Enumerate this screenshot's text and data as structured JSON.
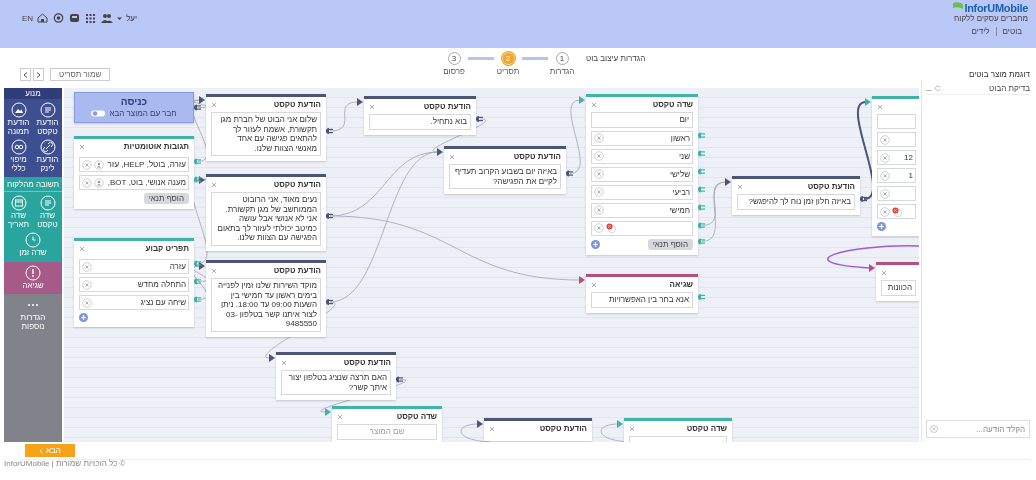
{
  "header": {
    "language": "EN",
    "user": "יעל",
    "logo": {
      "name": "InforUMobile",
      "tagline": "מחברים עסקים ללקוח"
    },
    "nav": [
      "בוטים",
      "לידים"
    ]
  },
  "toolbar": {
    "save_button": "שמור תסריט"
  },
  "stepper": {
    "title": "הגדרות עיצוב בוט",
    "steps": [
      {
        "number": "1",
        "label": "הגדרות",
        "selected": false
      },
      {
        "number": "2",
        "label": "תסריט",
        "selected": true
      },
      {
        "number": "3",
        "label": "פרסום",
        "selected": false
      }
    ]
  },
  "page_title": "דוגמת מוצר בוטים",
  "palette": {
    "title": "מנוע",
    "groups": [
      {
        "color": "#3d4f91",
        "items": [
          {
            "kind": "text",
            "label": "הודעת טקסט"
          },
          {
            "kind": "image",
            "label": "הודעת תמונה"
          },
          {
            "kind": "link",
            "label": "הודעת לינק"
          },
          {
            "kind": "loop",
            "label": "מיפוי כללי"
          }
        ]
      },
      {
        "color": "#2aa59e",
        "title": "תשובה מהלקוח",
        "items": [
          {
            "kind": "text",
            "label": "שדה טקסט"
          },
          {
            "kind": "calendar",
            "label": "שדה תאריך"
          },
          {
            "kind": "clock",
            "label": "שדה זמן"
          }
        ]
      },
      {
        "color": "#a55a87",
        "items": [
          {
            "kind": "alert",
            "label": "שגיאה"
          }
        ]
      },
      {
        "color": "#808389",
        "items": [
          {
            "kind": "more",
            "label": "הגדרות נוספות"
          }
        ]
      }
    ]
  },
  "canvas": {
    "nodes": [
      {
        "kind": "field",
        "rows": [
          {
            "warning": false
          },
          {
            "text": "12",
            "warning": false
          },
          {
            "text": "1",
            "warning": false
          },
          {
            "warning": false
          },
          {
            "warning": true
          }
        ],
        "add": true
      },
      {
        "kind": "error",
        "text": "הכוונות"
      },
      {
        "kind": "message",
        "title": "הודעת טקסט",
        "text": "באיזה חלון זמן נוח לך להיפגש?"
      },
      {
        "kind": "field",
        "title": "שדה טקסט",
        "value": "יום",
        "rows": [
          {
            "text": "ראשון",
            "warning": false
          },
          {
            "text": "שני",
            "warning": false
          },
          {
            "text": "שלישי",
            "warning": false
          },
          {
            "text": "רביעי",
            "warning": false
          },
          {
            "text": "חמישי",
            "warning": false
          },
          {
            "warning": true
          }
        ],
        "add": true,
        "button": "הוסף תנאי"
      },
      {
        "kind": "error",
        "title": "שגיאה",
        "text": "אנא בחר בין האפשרויות"
      },
      {
        "kind": "field",
        "title": "שדה טקסט"
      },
      {
        "kind": "message",
        "title": "הודעת טקסט",
        "text": "באיזה יום בשבוע הקרוב תעדיף לקיים את הפגישה?"
      },
      {
        "kind": "message",
        "title": "הודעת טקסט"
      },
      {
        "kind": "message",
        "title": "הודעת טקסט",
        "text": "בוא נתחיל."
      },
      {
        "kind": "message",
        "title": "הודעת טקסט",
        "text": "האם תרצה שנציג בטלפון יצור איתך קשר?"
      },
      {
        "kind": "field",
        "title": "שדה טקסט",
        "placeholder": "שם המוצר"
      },
      {
        "kind": "message",
        "title": "הודעת טקסט",
        "text": "שלום אני הבוט של חברת מגן תקשורת, אשמח לעזור לך להתאים פגישה עם אחד מאנשי הצוות שלנו."
      },
      {
        "kind": "message",
        "title": "הודעת טקסט",
        "text": "נעים מאוד, אני הרובוט הממוחשב של מגן תקשורת. אני לא אנושי אבל עושה כמיטב יכולתי לעזור לך בתאום הפגישה עם הצוות שלנו."
      },
      {
        "kind": "message",
        "title": "הודעת טקסט",
        "text": "מוקד השירות שלנו זמין לפנייה בימים ראשון עד חמישי בין השעות 09:00 עד 18:00. ניתן לצור איתנו קשר בטלפון 03-9485550"
      },
      {
        "kind": "entry",
        "title": "כניסה",
        "text": "חבר עם המוצר הבא"
      },
      {
        "kind": "replies",
        "title": "תגובות אוטומטיות",
        "rows": [
          {
            "text": "עזרה, בוטל, HELP, עזר"
          },
          {
            "text": "מענה אנושי, בוט, BOT,"
          }
        ],
        "button": "הוסף תנאי"
      },
      {
        "kind": "menu",
        "title": "תפריט קבוע",
        "rows": [
          {
            "text": "עזרה"
          },
          {
            "text": "התחלה מחדש"
          },
          {
            "text": "שיחה עם נציג"
          }
        ],
        "add": true
      }
    ]
  },
  "chat": {
    "title": "בדיקת הבוט",
    "placeholder": "הקלד הודעה..."
  },
  "footer": {
    "next_button": "הבא",
    "copyright": "InforUMobile | כל הזכויות שמורות ©"
  }
}
